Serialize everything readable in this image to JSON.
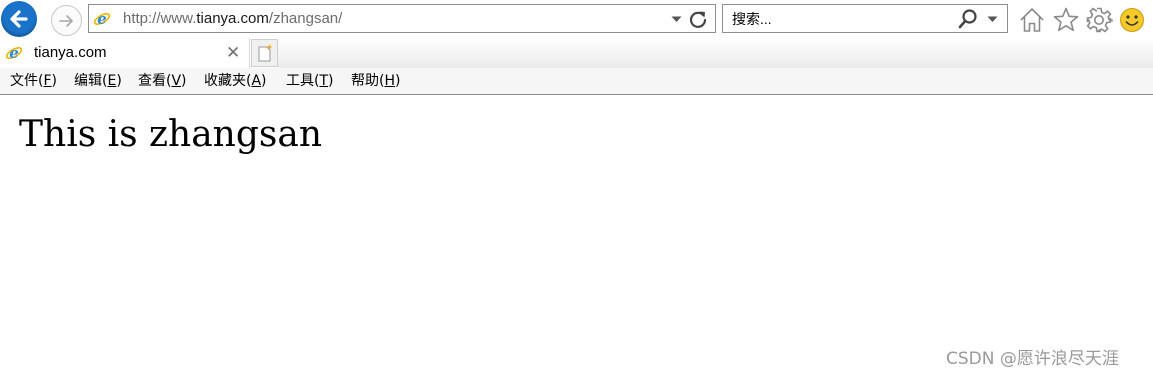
{
  "address_bar": {
    "url_prefix": "http://www.",
    "url_domain": "tianya.com",
    "url_path": "/zhangsan/"
  },
  "search": {
    "placeholder": "搜索..."
  },
  "tab": {
    "title": "tianya.com",
    "close_glyph": "✕"
  },
  "menu": {
    "file": {
      "label": "文件(",
      "key": "F",
      "end": ")"
    },
    "edit": {
      "label": "编辑(",
      "key": "E",
      "end": ")"
    },
    "view": {
      "label": "查看(",
      "key": "V",
      "end": ")"
    },
    "favorites": {
      "label": "收藏夹(",
      "key": "A",
      "end": ")"
    },
    "tools": {
      "label": "工具(",
      "key": "T",
      "end": ")"
    },
    "help": {
      "label": "帮助(",
      "key": "H",
      "end": ")"
    }
  },
  "page": {
    "heading": "This is zhangsan"
  },
  "watermark": "CSDN @愿许浪尽天涯",
  "icons": {
    "back": "back-arrow-icon",
    "forward": "forward-arrow-icon",
    "favicon": "ie-logo-icon",
    "refresh": "refresh-icon",
    "search": "search-icon",
    "home": "home-icon",
    "favorites": "star-icon",
    "settings": "gear-icon",
    "feedback": "smiley-icon",
    "new_tab": "new-tab-icon"
  },
  "colors": {
    "back_button": "#1a73c9",
    "ie_logo": "#2a8ad9",
    "ie_ring": "#f0b400",
    "menu_bar": "#f6f6f6",
    "smiley": "#f6c928"
  }
}
